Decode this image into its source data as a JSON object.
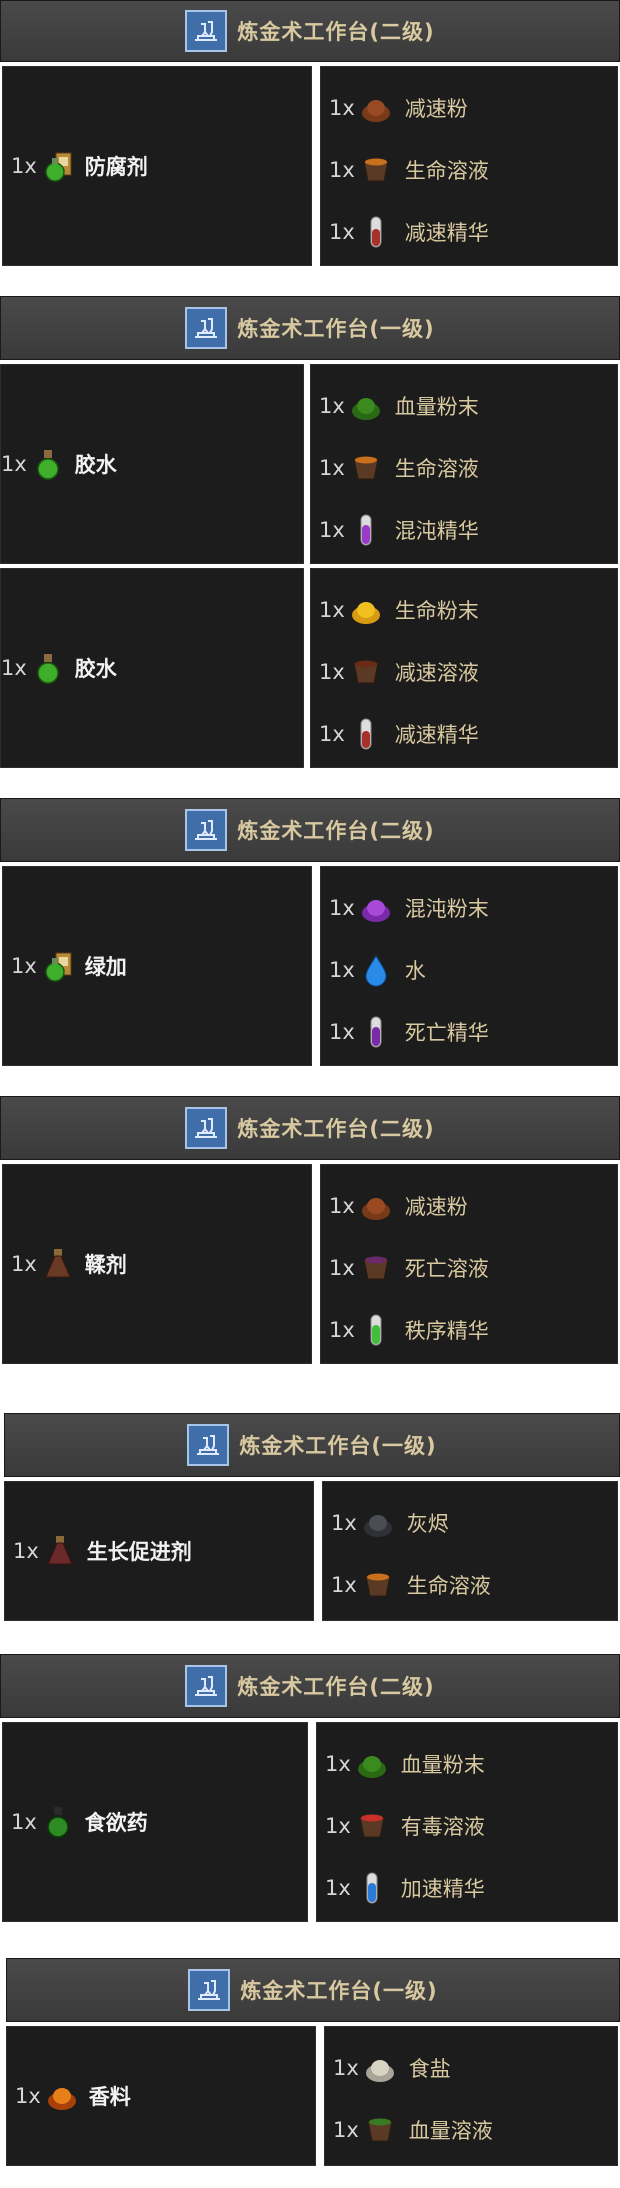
{
  "recipes": [
    {
      "station": "炼金术工作台(二级)",
      "output": {
        "qty": "1x",
        "name": "防腐剂",
        "icon": "green-potion-box-icon"
      },
      "inputs": [
        {
          "qty": "1x",
          "name": "减速粉",
          "icon": "brown-powder-icon"
        },
        {
          "qty": "1x",
          "name": "生命溶液",
          "icon": "orange-solution-cup-icon"
        },
        {
          "qty": "1x",
          "name": "减速精华",
          "icon": "red-essence-vial-icon"
        }
      ]
    },
    {
      "station": "炼金术工作台(一级)",
      "output": {
        "qty": "1x",
        "name": "胶水",
        "icon": "green-flask-icon"
      },
      "inputs": [
        {
          "qty": "1x",
          "name": "血量粉末",
          "icon": "green-powder-icon"
        },
        {
          "qty": "1x",
          "name": "生命溶液",
          "icon": "orange-solution-cup-icon"
        },
        {
          "qty": "1x",
          "name": "混沌精华",
          "icon": "purple-essence-vial-icon"
        }
      ]
    },
    {
      "station": "",
      "output": {
        "qty": "1x",
        "name": "胶水",
        "icon": "green-flask-icon"
      },
      "inputs": [
        {
          "qty": "1x",
          "name": "生命粉末",
          "icon": "yellow-powder-icon"
        },
        {
          "qty": "1x",
          "name": "减速溶液",
          "icon": "brown-solution-cup-icon"
        },
        {
          "qty": "1x",
          "name": "减速精华",
          "icon": "red-essence-vial-icon"
        }
      ]
    },
    {
      "station": "炼金术工作台(二级)",
      "output": {
        "qty": "1x",
        "name": "绿加",
        "icon": "green-potion-box-icon"
      },
      "inputs": [
        {
          "qty": "1x",
          "name": "混沌粉末",
          "icon": "purple-powder-icon"
        },
        {
          "qty": "1x",
          "name": "水",
          "icon": "water-drop-icon"
        },
        {
          "qty": "1x",
          "name": "死亡精华",
          "icon": "purple-essence-vial-icon"
        }
      ]
    },
    {
      "station": "炼金术工作台(二级)",
      "output": {
        "qty": "1x",
        "name": "鞣剂",
        "icon": "brown-flask-icon"
      },
      "inputs": [
        {
          "qty": "1x",
          "name": "减速粉",
          "icon": "brown-powder-icon"
        },
        {
          "qty": "1x",
          "name": "死亡溶液",
          "icon": "purple-solution-cup-icon"
        },
        {
          "qty": "1x",
          "name": "秩序精华",
          "icon": "green-essence-vial-icon"
        }
      ]
    },
    {
      "station": "炼金术工作台(一级)",
      "output": {
        "qty": "1x",
        "name": "生长促进剂",
        "icon": "dark-red-flask-icon"
      },
      "inputs": [
        {
          "qty": "1x",
          "name": "灰烬",
          "icon": "ash-pile-icon"
        },
        {
          "qty": "1x",
          "name": "生命溶液",
          "icon": "orange-solution-cup-icon"
        }
      ]
    },
    {
      "station": "炼金术工作台(二级)",
      "output": {
        "qty": "1x",
        "name": "食欲药",
        "icon": "green-round-flask-icon"
      },
      "inputs": [
        {
          "qty": "1x",
          "name": "血量粉末",
          "icon": "green-powder-icon"
        },
        {
          "qty": "1x",
          "name": "有毒溶液",
          "icon": "red-solution-cup-icon"
        },
        {
          "qty": "1x",
          "name": "加速精华",
          "icon": "blue-essence-vial-icon"
        }
      ]
    },
    {
      "station": "炼金术工作台(一级)",
      "output": {
        "qty": "1x",
        "name": "香料",
        "icon": "orange-powder-icon"
      },
      "inputs": [
        {
          "qty": "1x",
          "name": "食盐",
          "icon": "salt-pile-icon"
        },
        {
          "qty": "1x",
          "name": "血量溶液",
          "icon": "green-solution-cup-icon"
        }
      ]
    }
  ],
  "colors": {
    "green": "#3fae2a",
    "brown": "#7a3a1a",
    "orange": "#c8701a",
    "red": "#a8302a",
    "purple": "#9a3ac8",
    "yellow": "#e8b820",
    "blue": "#2a7ad8",
    "ash": "#4a4e52",
    "salt": "#d8d4c4",
    "darkred": "#7a2a2a"
  }
}
